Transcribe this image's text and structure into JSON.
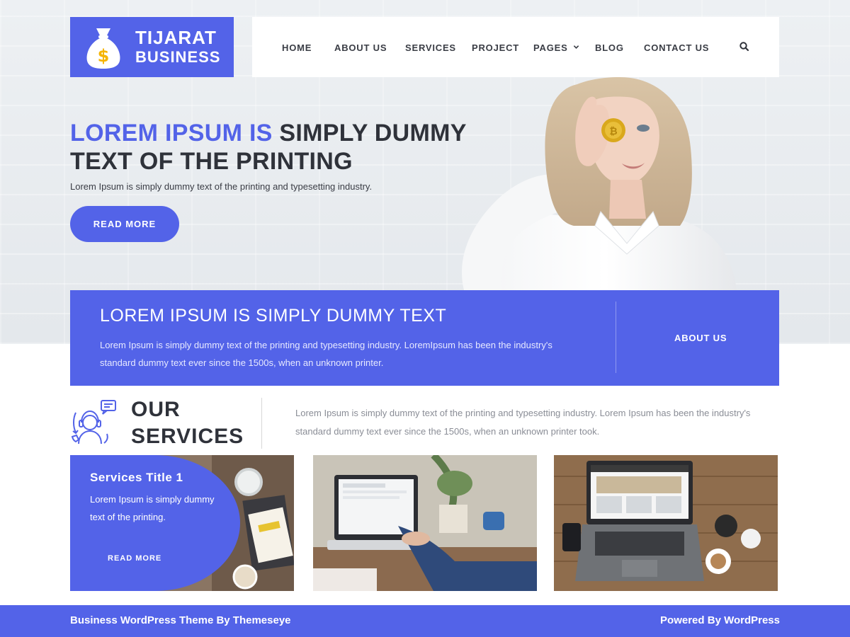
{
  "logo": {
    "line1": "TIJARAT",
    "line2": "BUSINESS",
    "icon": "money-bag-icon"
  },
  "nav": {
    "items": [
      "HOME",
      "ABOUT US",
      "SERVICES",
      "PROJECT",
      "PAGES",
      "BLOG",
      "CONTACT US"
    ],
    "pages_caret": "⌄",
    "search_icon": "search-icon"
  },
  "hero": {
    "title_accent": "LOREM IPSUM IS",
    "title_rest": " SIMPLY DUMMY TEXT OF THE PRINTING",
    "subtitle": "Lorem Ipsum is simply dummy text of the printing and typesetting industry.",
    "button": "READ MORE"
  },
  "banner": {
    "title": "LOREM IPSUM IS SIMPLY DUMMY TEXT",
    "text": "Lorem Ipsum is simply dummy text of the printing and typesetting industry. LoremIpsum has been the industry's standard dummy text ever since the 1500s, when an unknown printer.",
    "link": "ABOUT US"
  },
  "services": {
    "heading_line1": "OUR",
    "heading_line2": "SERVICES",
    "description": "Lorem Ipsum is simply dummy text of the printing and typesetting industry. Lorem Ipsum has been the industry's standard dummy text ever since the 1500s, when an unknown printer took.",
    "icon": "customer-support-icon",
    "cards": [
      {
        "title": "Services Title 1",
        "desc": "Lorem Ipsum is simply dummy text of the printing.",
        "more": "READ MORE"
      }
    ]
  },
  "footer": {
    "left": "Business WordPress Theme By Themeseye",
    "right": "Powered By WordPress"
  },
  "colors": {
    "accent": "#5363e8",
    "text_dark": "#2f323a",
    "text_muted": "#8a8d96"
  }
}
